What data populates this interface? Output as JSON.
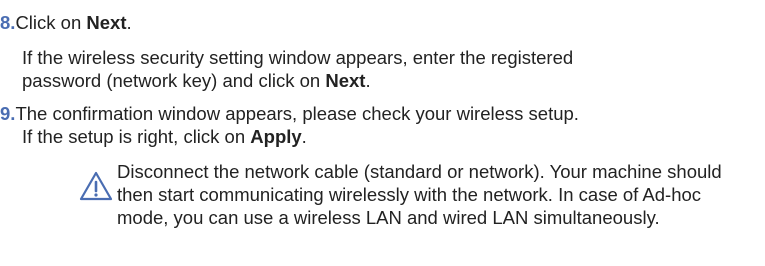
{
  "step8": {
    "number": "8.",
    "text_before": "Click on ",
    "action": "Next",
    "text_after": "."
  },
  "step8_detail": {
    "line1": "If the wireless security setting window appears, enter the registered",
    "line2_before": "password (network key) and click on ",
    "line2_action": "Next",
    "line2_after": "."
  },
  "step9": {
    "number": "9.",
    "line1": "The confirmation window appears, please check your wireless setup.",
    "line2_before": "If the setup is right, click on ",
    "line2_action": "Apply",
    "line2_after": "."
  },
  "note": {
    "icon": "warning-triangle-icon",
    "text": "Disconnect the network cable (standard or network). Your machine should then start communicating wirelessly with the network. In case of Ad-hoc mode, you can use a wireless LAN and wired LAN simultaneously."
  },
  "colors": {
    "step_number": "#4a6db2",
    "icon": "#4a6db2",
    "text": "#222222"
  }
}
